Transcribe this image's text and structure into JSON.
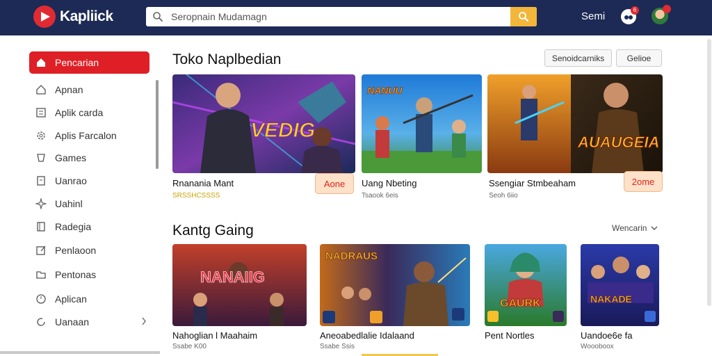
{
  "header": {
    "logo": "Kapliick",
    "search_placeholder": "Seropnain Mudamagn",
    "user_name": "Semi",
    "notif_count": "6"
  },
  "sidebar": {
    "items": [
      {
        "label": "Pencarian",
        "icon": "home-icon"
      },
      {
        "label": "Apnan",
        "icon": "home-outline-icon"
      },
      {
        "label": "Aplik carda",
        "icon": "list-icon"
      },
      {
        "label": "Aplis Farcalon",
        "icon": "gear-icon"
      },
      {
        "label": "Games",
        "icon": "cup-icon"
      },
      {
        "label": "Uanrao",
        "icon": "document-icon"
      },
      {
        "label": "Uahinl",
        "icon": "sparkle-icon"
      },
      {
        "label": "Radegia",
        "icon": "book-icon"
      },
      {
        "label": "Penlaoon",
        "icon": "edit-icon"
      },
      {
        "label": "Pentonas",
        "icon": "folder-icon"
      },
      {
        "label": "Aplican",
        "icon": "clock-icon"
      },
      {
        "label": "Uanaan",
        "icon": "refresh-icon"
      }
    ]
  },
  "featured": {
    "title": "Toko Naplbedian",
    "filter_1": "Senoidcarniks",
    "filter_2": "Gelioe",
    "games": [
      {
        "title": "Rnanania Mant",
        "sub": "SRSSHCSSSS",
        "price": "Aone",
        "art": "VEDIG"
      },
      {
        "title": "Uang Nbeting",
        "sub": "Tsaook 6eis",
        "art": "NANUU"
      },
      {
        "title": "Ssengiar Stmbeaham",
        "sub": "Seoh 6iio",
        "price": "2ome",
        "art": "AUAUGEIA"
      }
    ]
  },
  "popular": {
    "title": "Kantg Gaing",
    "more_link": "Wencarin",
    "games": [
      {
        "title": "Nahoglian l Maahaim",
        "sub": "Ssabe K00",
        "art": "NANAIIG"
      },
      {
        "title": "Aneoabedlalie Idalaand",
        "sub": "Ssabe Ssis",
        "art": "NADRAUS"
      },
      {
        "title": "Pent Nortles",
        "sub": "",
        "art": "GAURK"
      },
      {
        "title": "Uandoe6e fa",
        "sub": "Woooboox",
        "art": "NAKADE"
      }
    ]
  },
  "colors": {
    "topbar": "#1c2a55",
    "accent_red": "#df1f26",
    "search_button": "#f2b63a"
  }
}
